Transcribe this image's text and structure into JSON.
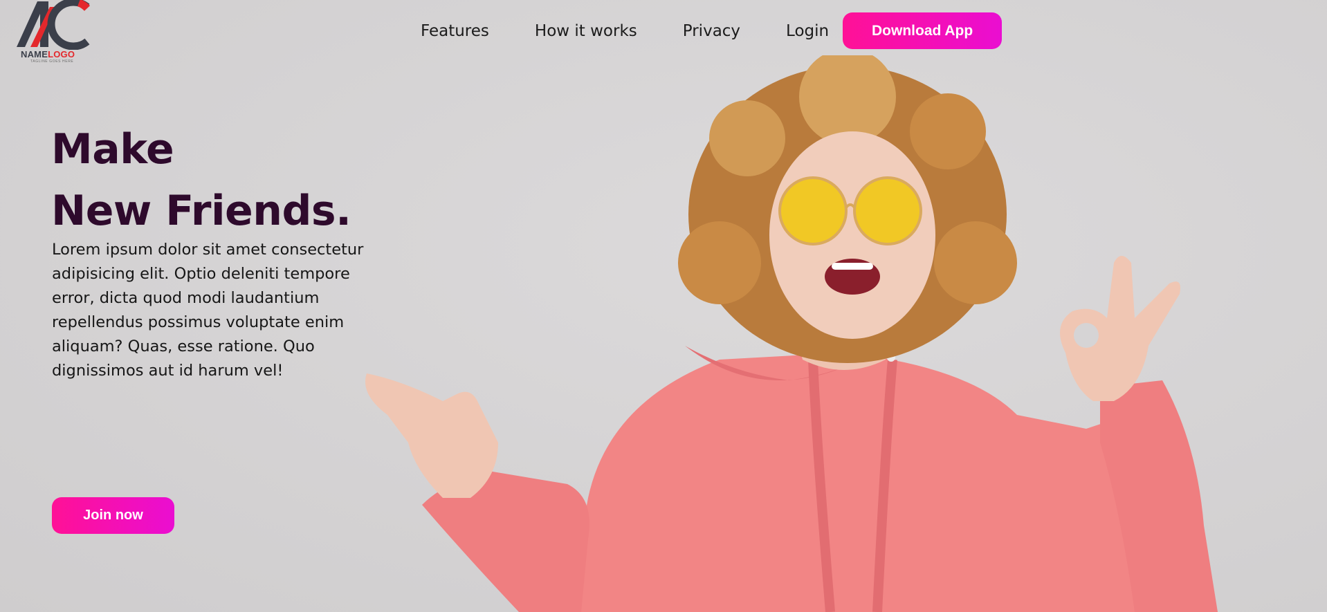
{
  "logo": {
    "name_part1": "NAME",
    "name_part2": "LOGO",
    "tagline": "TAGLINE GOES HERE",
    "colors": {
      "dark": "#3b3f4a",
      "red": "#e4282c"
    }
  },
  "nav": {
    "links": [
      "Features",
      "How it works",
      "Privacy",
      "Login"
    ],
    "download_label": "Download App"
  },
  "hero": {
    "title_line1": "Make",
    "title_line2": "New Friends.",
    "body": "Lorem ipsum dolor sit amet consectetur adipisicing elit. Optio deleniti tempore error, dicta quod modi laudantium repellendus possimus voluptate enim aliquam? Quas, esse ratione. Quo dignissimos aut id harum vel!",
    "join_label": "Join now"
  },
  "colors": {
    "accent_start": "#ff1196",
    "accent_end": "#ea0ed1",
    "heading": "#2e0a2c",
    "background": "#d6d4d5",
    "hoodie": "#f28585",
    "hair": "#c98a45",
    "glasses": "#f2c81e"
  }
}
